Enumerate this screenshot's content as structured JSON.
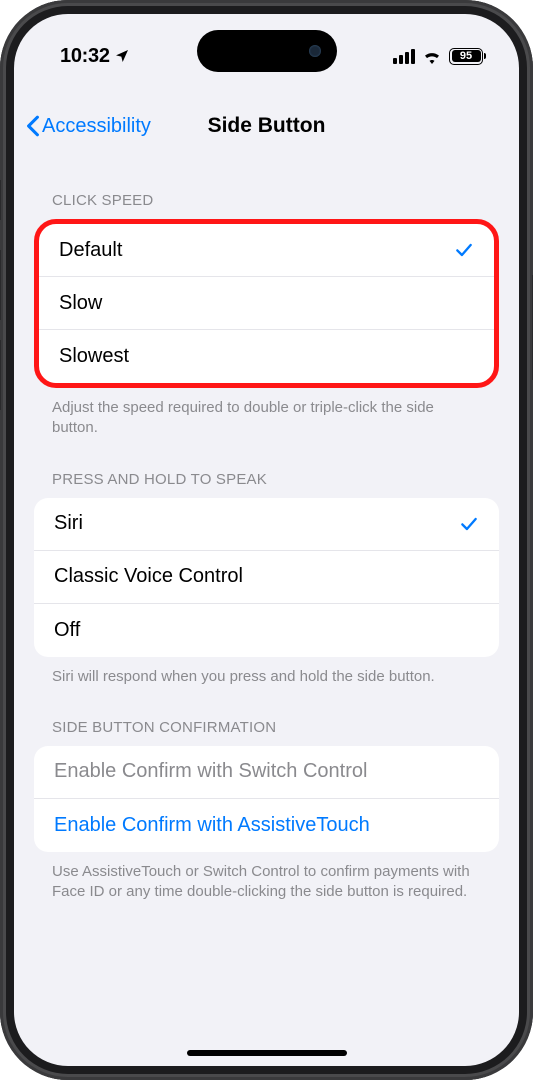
{
  "status_bar": {
    "time": "10:32",
    "battery_percent": "95"
  },
  "nav": {
    "back_label": "Accessibility",
    "title": "Side Button"
  },
  "sections": {
    "click_speed": {
      "header": "CLICK SPEED",
      "items": [
        {
          "label": "Default",
          "selected": true
        },
        {
          "label": "Slow",
          "selected": false
        },
        {
          "label": "Slowest",
          "selected": false
        }
      ],
      "footer": "Adjust the speed required to double or triple-click the side button."
    },
    "press_hold": {
      "header": "PRESS AND HOLD TO SPEAK",
      "items": [
        {
          "label": "Siri",
          "selected": true
        },
        {
          "label": "Classic Voice Control",
          "selected": false
        },
        {
          "label": "Off",
          "selected": false
        }
      ],
      "footer": "Siri will respond when you press and hold the side button."
    },
    "confirmation": {
      "header": "SIDE BUTTON CONFIRMATION",
      "items": [
        {
          "label": "Enable Confirm with Switch Control",
          "enabled": false
        },
        {
          "label": "Enable Confirm with AssistiveTouch",
          "enabled": true
        }
      ],
      "footer": "Use AssistiveTouch or Switch Control to confirm payments with Face ID or any time double-clicking the side button is required."
    }
  }
}
